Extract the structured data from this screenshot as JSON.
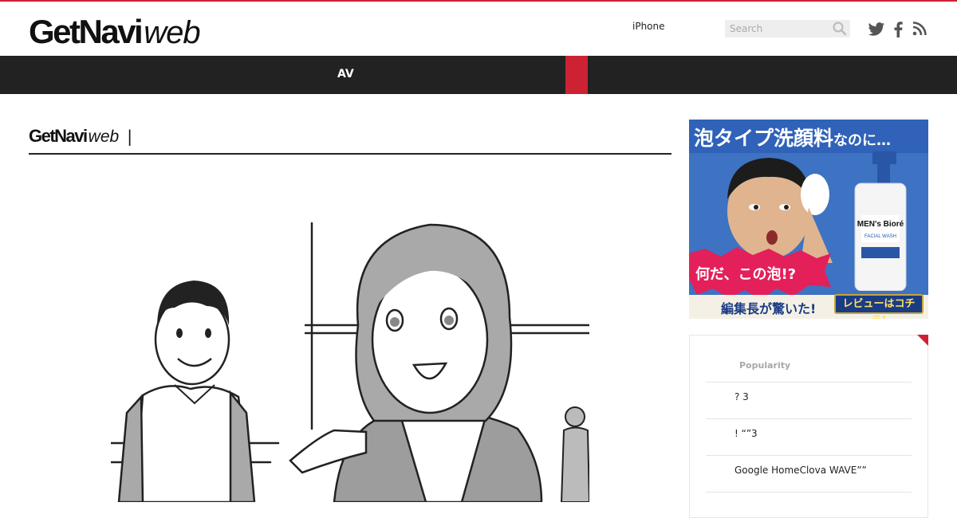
{
  "brand": {
    "logo_bold": "GetNavi",
    "logo_web": "web"
  },
  "header": {
    "nav_link": "iPhone",
    "search_placeholder": "Search",
    "social": [
      "twitter-icon",
      "facebook-icon",
      "rss-icon"
    ]
  },
  "menubar": {
    "item": "AV",
    "accent_color": "#cc2233"
  },
  "main": {
    "title_bold": "GetNavi",
    "title_web": "web",
    "title_sep": "|"
  },
  "ad": {
    "headline_big": "泡タイプ洗顔料",
    "headline_small": "なのに…",
    "burst_text": "何だ、この泡!?",
    "footer_text": "編集長が驚いた!",
    "cta_label": "レビューはコチラ!",
    "bottle_brand": "MEN's Bioré",
    "bottle_sub": "FACIAL WASH"
  },
  "popularity": {
    "tab_label": "Popularity",
    "items": [
      "? 3",
      "! “”3",
      "Google HomeClova WAVE””"
    ]
  },
  "colors": {
    "accent": "#cc2233",
    "menubar_bg": "#222222",
    "ad_blue": "#3e72c2"
  }
}
